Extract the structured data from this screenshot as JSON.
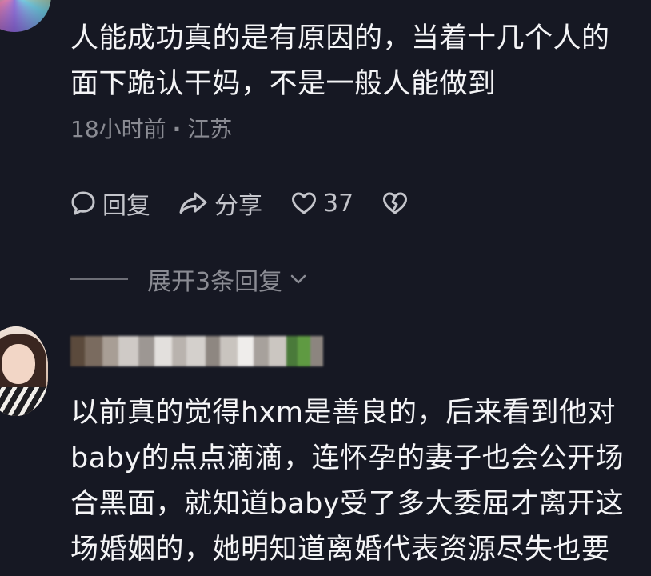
{
  "comments": [
    {
      "text_lines": [
        "人能成功真的是有原因的，当着十几个人的",
        "面下跪认干妈，不是一般人能做到"
      ],
      "time": "18小时前",
      "separator": "·",
      "location": "江苏",
      "actions": {
        "reply_label": "回复",
        "share_label": "分享",
        "likes": "37"
      },
      "expand_label": "展开3条回复"
    },
    {
      "text_lines": [
        "以前真的觉得hxm是善良的，后来看到他对",
        "baby的点点滴滴，连怀孕的妻子也会公开场",
        "合黑面，就知道baby受了多大委屈才离开这",
        "场婚姻的，她明知道离婚代表资源尽失也要"
      ]
    }
  ],
  "colors": {
    "background": "#161823",
    "text": "#f4f4f6",
    "meta": "#8a8b93",
    "action": "#c4c5cb"
  },
  "icons": {
    "reply": "comment-bubble-icon",
    "share": "share-arrow-icon",
    "like": "heart-outline-icon",
    "dislike": "broken-heart-icon",
    "expand": "chevron-down-icon"
  }
}
